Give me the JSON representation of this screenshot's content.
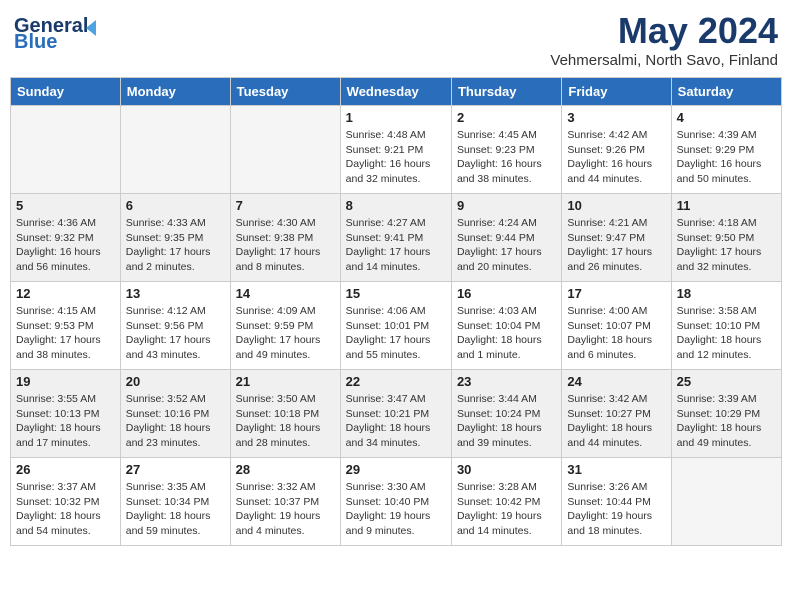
{
  "header": {
    "logo_line1": "General",
    "logo_line2": "Blue",
    "main_title": "May 2024",
    "subtitle": "Vehmersalmi, North Savo, Finland"
  },
  "weekdays": [
    "Sunday",
    "Monday",
    "Tuesday",
    "Wednesday",
    "Thursday",
    "Friday",
    "Saturday"
  ],
  "weeks": [
    [
      {
        "day": "",
        "info": ""
      },
      {
        "day": "",
        "info": ""
      },
      {
        "day": "",
        "info": ""
      },
      {
        "day": "1",
        "info": "Sunrise: 4:48 AM\nSunset: 9:21 PM\nDaylight: 16 hours\nand 32 minutes."
      },
      {
        "day": "2",
        "info": "Sunrise: 4:45 AM\nSunset: 9:23 PM\nDaylight: 16 hours\nand 38 minutes."
      },
      {
        "day": "3",
        "info": "Sunrise: 4:42 AM\nSunset: 9:26 PM\nDaylight: 16 hours\nand 44 minutes."
      },
      {
        "day": "4",
        "info": "Sunrise: 4:39 AM\nSunset: 9:29 PM\nDaylight: 16 hours\nand 50 minutes."
      }
    ],
    [
      {
        "day": "5",
        "info": "Sunrise: 4:36 AM\nSunset: 9:32 PM\nDaylight: 16 hours\nand 56 minutes."
      },
      {
        "day": "6",
        "info": "Sunrise: 4:33 AM\nSunset: 9:35 PM\nDaylight: 17 hours\nand 2 minutes."
      },
      {
        "day": "7",
        "info": "Sunrise: 4:30 AM\nSunset: 9:38 PM\nDaylight: 17 hours\nand 8 minutes."
      },
      {
        "day": "8",
        "info": "Sunrise: 4:27 AM\nSunset: 9:41 PM\nDaylight: 17 hours\nand 14 minutes."
      },
      {
        "day": "9",
        "info": "Sunrise: 4:24 AM\nSunset: 9:44 PM\nDaylight: 17 hours\nand 20 minutes."
      },
      {
        "day": "10",
        "info": "Sunrise: 4:21 AM\nSunset: 9:47 PM\nDaylight: 17 hours\nand 26 minutes."
      },
      {
        "day": "11",
        "info": "Sunrise: 4:18 AM\nSunset: 9:50 PM\nDaylight: 17 hours\nand 32 minutes."
      }
    ],
    [
      {
        "day": "12",
        "info": "Sunrise: 4:15 AM\nSunset: 9:53 PM\nDaylight: 17 hours\nand 38 minutes."
      },
      {
        "day": "13",
        "info": "Sunrise: 4:12 AM\nSunset: 9:56 PM\nDaylight: 17 hours\nand 43 minutes."
      },
      {
        "day": "14",
        "info": "Sunrise: 4:09 AM\nSunset: 9:59 PM\nDaylight: 17 hours\nand 49 minutes."
      },
      {
        "day": "15",
        "info": "Sunrise: 4:06 AM\nSunset: 10:01 PM\nDaylight: 17 hours\nand 55 minutes."
      },
      {
        "day": "16",
        "info": "Sunrise: 4:03 AM\nSunset: 10:04 PM\nDaylight: 18 hours\nand 1 minute."
      },
      {
        "day": "17",
        "info": "Sunrise: 4:00 AM\nSunset: 10:07 PM\nDaylight: 18 hours\nand 6 minutes."
      },
      {
        "day": "18",
        "info": "Sunrise: 3:58 AM\nSunset: 10:10 PM\nDaylight: 18 hours\nand 12 minutes."
      }
    ],
    [
      {
        "day": "19",
        "info": "Sunrise: 3:55 AM\nSunset: 10:13 PM\nDaylight: 18 hours\nand 17 minutes."
      },
      {
        "day": "20",
        "info": "Sunrise: 3:52 AM\nSunset: 10:16 PM\nDaylight: 18 hours\nand 23 minutes."
      },
      {
        "day": "21",
        "info": "Sunrise: 3:50 AM\nSunset: 10:18 PM\nDaylight: 18 hours\nand 28 minutes."
      },
      {
        "day": "22",
        "info": "Sunrise: 3:47 AM\nSunset: 10:21 PM\nDaylight: 18 hours\nand 34 minutes."
      },
      {
        "day": "23",
        "info": "Sunrise: 3:44 AM\nSunset: 10:24 PM\nDaylight: 18 hours\nand 39 minutes."
      },
      {
        "day": "24",
        "info": "Sunrise: 3:42 AM\nSunset: 10:27 PM\nDaylight: 18 hours\nand 44 minutes."
      },
      {
        "day": "25",
        "info": "Sunrise: 3:39 AM\nSunset: 10:29 PM\nDaylight: 18 hours\nand 49 minutes."
      }
    ],
    [
      {
        "day": "26",
        "info": "Sunrise: 3:37 AM\nSunset: 10:32 PM\nDaylight: 18 hours\nand 54 minutes."
      },
      {
        "day": "27",
        "info": "Sunrise: 3:35 AM\nSunset: 10:34 PM\nDaylight: 18 hours\nand 59 minutes."
      },
      {
        "day": "28",
        "info": "Sunrise: 3:32 AM\nSunset: 10:37 PM\nDaylight: 19 hours\nand 4 minutes."
      },
      {
        "day": "29",
        "info": "Sunrise: 3:30 AM\nSunset: 10:40 PM\nDaylight: 19 hours\nand 9 minutes."
      },
      {
        "day": "30",
        "info": "Sunrise: 3:28 AM\nSunset: 10:42 PM\nDaylight: 19 hours\nand 14 minutes."
      },
      {
        "day": "31",
        "info": "Sunrise: 3:26 AM\nSunset: 10:44 PM\nDaylight: 19 hours\nand 18 minutes."
      },
      {
        "day": "",
        "info": ""
      }
    ]
  ]
}
